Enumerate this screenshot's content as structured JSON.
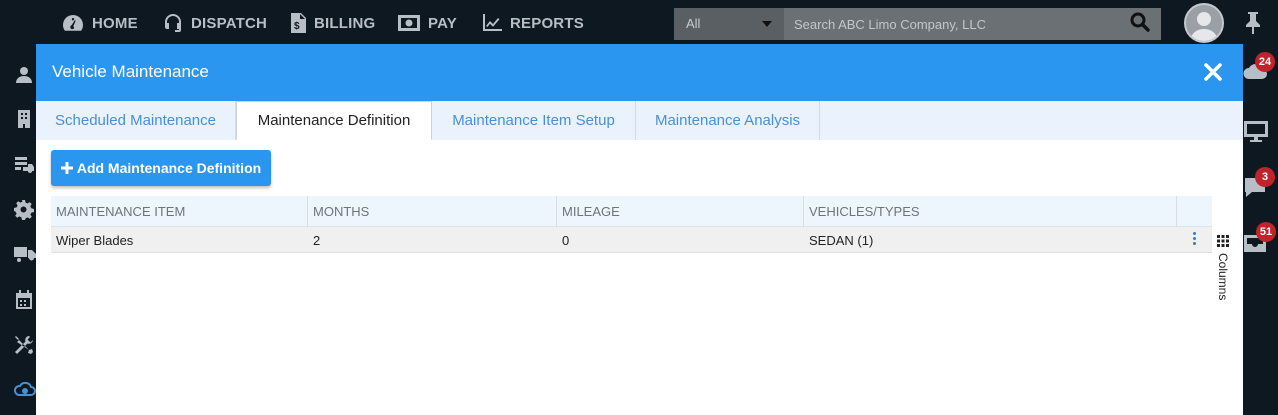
{
  "nav": {
    "items": [
      {
        "label": "HOME",
        "icon": "dashboard-icon"
      },
      {
        "label": "DISPATCH",
        "icon": "headset-icon"
      },
      {
        "label": "BILLING",
        "icon": "invoice-icon"
      },
      {
        "label": "PAY",
        "icon": "money-icon"
      },
      {
        "label": "REPORTS",
        "icon": "chart-icon"
      }
    ],
    "search_scope": "All",
    "search_placeholder": "Search ABC Limo Company, LLC"
  },
  "right_sidebar": {
    "badges": [
      "24",
      "3",
      "51"
    ]
  },
  "modal": {
    "title": "Vehicle Maintenance",
    "tabs": [
      {
        "label": "Scheduled Maintenance",
        "active": false
      },
      {
        "label": "Maintenance Definition",
        "active": true
      },
      {
        "label": "Maintenance Item Setup",
        "active": false
      },
      {
        "label": "Maintenance Analysis",
        "active": false
      }
    ],
    "add_button": "Add Maintenance Definition",
    "grid": {
      "headers": [
        "MAINTENANCE ITEM",
        "MONTHS",
        "MILEAGE",
        "VEHICLES/TYPES"
      ],
      "rows": [
        [
          "Wiper Blades",
          "2",
          "0",
          "SEDAN (1)"
        ]
      ]
    },
    "columns_label": "Columns"
  },
  "colors": {
    "accent": "#2b96ef",
    "badge": "#c0232b",
    "nav_bg": "#0d1821"
  }
}
